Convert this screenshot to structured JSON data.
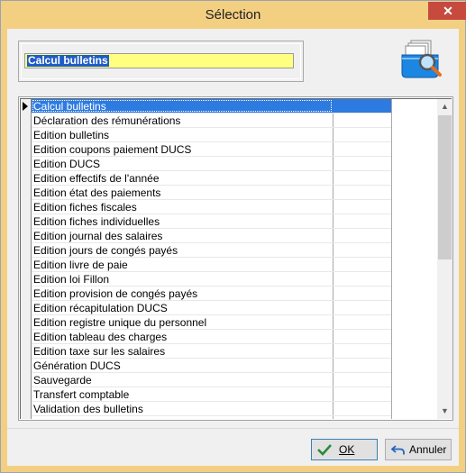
{
  "window": {
    "title": "Sélection",
    "close_glyph": "✕"
  },
  "selection_field": {
    "value": "Calcul bulletins"
  },
  "header_icon": "folders-search-icon",
  "list": {
    "items": [
      "Calcul bulletins",
      "Déclaration des rémunérations",
      "Edition bulletins",
      "Edition coupons paiement DUCS",
      "Edition DUCS",
      "Edition effectifs de l'année",
      "Edition état des paiements",
      "Edition fiches fiscales",
      "Edition fiches individuelles",
      "Edition journal des salaires",
      "Edition jours de congés payés",
      "Edition livre de paie",
      "Edition loi Fillon",
      "Edition provision de congés payés",
      "Edition récapitulation DUCS",
      "Edition registre unique du personnel",
      "Edition tableau des charges",
      "Edition taxe sur les salaires",
      "Génération DUCS",
      "Sauvegarde",
      "Transfert comptable",
      "Validation des bulletins"
    ],
    "selected_index": 0,
    "scroll_up_glyph": "▲",
    "scroll_down_glyph": "▼"
  },
  "buttons": {
    "ok_label": "OK",
    "cancel_label": "Annuler"
  },
  "colors": {
    "title_bar": "#f3cf82",
    "selection_highlight": "#2d7be0",
    "input_bg": "#ffff80",
    "close_button": "#c74a3f"
  }
}
